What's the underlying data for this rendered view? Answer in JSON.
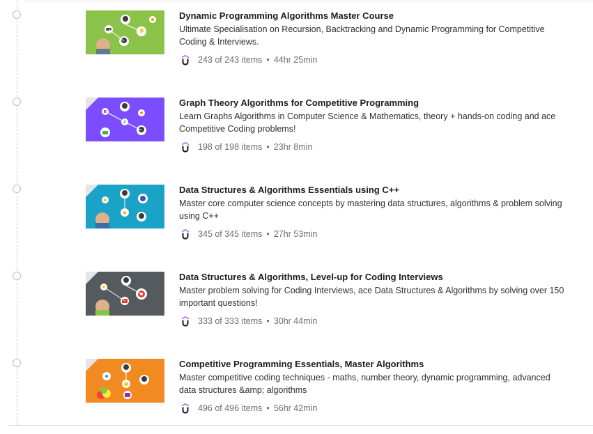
{
  "courses": [
    {
      "title": "Dynamic Programming Algorithms Master Course",
      "description": "Ultimate Specialisation on Recursion, Backtracking and Dynamic Programming for Competitive Coding & Interviews.",
      "items": "243 of 243 items",
      "duration": "44hr 25min",
      "thumb_color": "#8bc34a",
      "provider_icon": "udemy-logo-icon"
    },
    {
      "title": "Graph Theory Algorithms for Competitive Programming",
      "description": "Learn Graphs Algorithms in Computer Science & Mathematics, theory + hands-on coding and ace Competitive Coding problems!",
      "items": "198 of 198 items",
      "duration": "23hr 8min",
      "thumb_color": "#7c4dff",
      "provider_icon": "udemy-logo-icon"
    },
    {
      "title": "Data Structures & Algorithms Essentials using C++",
      "description": "Master core computer science concepts by mastering data structures, algorithms & problem solving using C++",
      "items": "345 of 345 items",
      "duration": "27hr 53min",
      "thumb_color": "#1aa3c7",
      "provider_icon": "udemy-logo-icon"
    },
    {
      "title": "Data Structures & Algorithms, Level-up for Coding Interviews",
      "description": "Master problem solving for Coding Interviews, ace Data Structures & Algorithms by solving over 150 important questions!",
      "items": "333 of 333 items",
      "duration": "30hr 44min",
      "thumb_color": "#555a5e",
      "provider_icon": "udemy-logo-icon"
    },
    {
      "title": "Competitive Programming Essentials, Master Algorithms",
      "description": "Master competitive coding techniques - maths, number theory, dynamic programming, advanced data structures &amp; algorithms",
      "items": "496 of 496 items",
      "duration": "56hr 42min",
      "thumb_color": "#f28a22",
      "provider_icon": "udemy-logo-icon"
    }
  ],
  "separator": "•"
}
